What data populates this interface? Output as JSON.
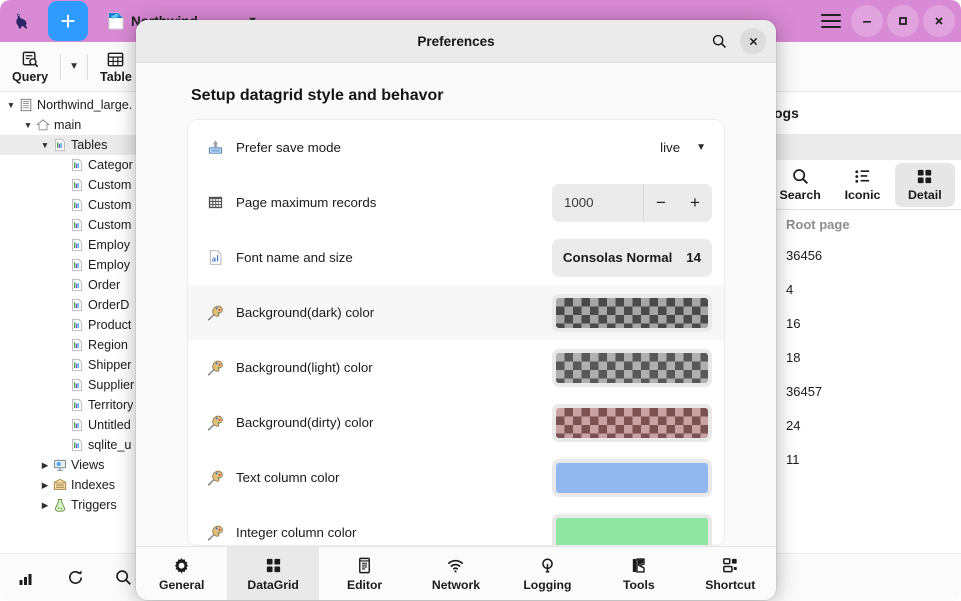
{
  "app": {
    "logo_icon": "kangaroo-logo",
    "new_tab_label": "+",
    "tab_title": "Northwind",
    "window_controls": {
      "menu": "hamburger-icon",
      "minimize": "minimize-icon",
      "maximize": "maximize-icon",
      "close": "close-icon"
    },
    "toolbar": [
      {
        "label": "Query",
        "icon": "query-icon"
      },
      {
        "label": "Table",
        "icon": "table-icon"
      }
    ],
    "statusbar": [
      {
        "icon": "chart-bars-icon",
        "name": "statistics-button"
      },
      {
        "icon": "refresh-icon",
        "name": "refresh-button"
      },
      {
        "icon": "search-icon",
        "name": "search-button"
      }
    ]
  },
  "sidebar": {
    "items": [
      {
        "label": "Northwind_large.",
        "depth": 0,
        "twisty": "down",
        "icon": "database-icon",
        "selected": false
      },
      {
        "label": "main",
        "depth": 1,
        "twisty": "down",
        "icon": "home-icon",
        "selected": false
      },
      {
        "label": "Tables",
        "depth": 2,
        "twisty": "down",
        "icon": "table-icon",
        "selected": true
      },
      {
        "label": "Categor",
        "depth": 3,
        "twisty": "none",
        "icon": "table-icon",
        "selected": false
      },
      {
        "label": "Custom",
        "depth": 3,
        "twisty": "none",
        "icon": "table-icon",
        "selected": false
      },
      {
        "label": "Custom",
        "depth": 3,
        "twisty": "none",
        "icon": "table-icon",
        "selected": false
      },
      {
        "label": "Custom",
        "depth": 3,
        "twisty": "none",
        "icon": "table-icon",
        "selected": false
      },
      {
        "label": "Employ",
        "depth": 3,
        "twisty": "none",
        "icon": "table-icon",
        "selected": false
      },
      {
        "label": "Employ",
        "depth": 3,
        "twisty": "none",
        "icon": "table-icon",
        "selected": false
      },
      {
        "label": "Order",
        "depth": 3,
        "twisty": "none",
        "icon": "table-icon",
        "selected": false
      },
      {
        "label": "OrderD",
        "depth": 3,
        "twisty": "none",
        "icon": "table-icon",
        "selected": false
      },
      {
        "label": "Product",
        "depth": 3,
        "twisty": "none",
        "icon": "table-icon",
        "selected": false
      },
      {
        "label": "Region",
        "depth": 3,
        "twisty": "none",
        "icon": "table-icon",
        "selected": false
      },
      {
        "label": "Shipper",
        "depth": 3,
        "twisty": "none",
        "icon": "table-icon",
        "selected": false
      },
      {
        "label": "Supplier",
        "depth": 3,
        "twisty": "none",
        "icon": "table-icon",
        "selected": false
      },
      {
        "label": "Territory",
        "depth": 3,
        "twisty": "none",
        "icon": "table-icon",
        "selected": false
      },
      {
        "label": "Untitled",
        "depth": 3,
        "twisty": "none",
        "icon": "table-icon",
        "selected": false
      },
      {
        "label": "sqlite_u",
        "depth": 3,
        "twisty": "none",
        "icon": "table-icon",
        "selected": false
      },
      {
        "label": "Views",
        "depth": 2,
        "twisty": "right",
        "icon": "views-icon",
        "selected": false
      },
      {
        "label": "Indexes",
        "depth": 2,
        "twisty": "right",
        "icon": "indexes-icon",
        "selected": false
      },
      {
        "label": "Triggers",
        "depth": 2,
        "twisty": "right",
        "icon": "triggers-icon",
        "selected": false
      }
    ]
  },
  "right_panel": {
    "heading": "ogs",
    "view_buttons": [
      {
        "label": "Search",
        "icon": "search-icon",
        "active": false
      },
      {
        "label": "Iconic",
        "icon": "list-icon",
        "active": false
      },
      {
        "label": "Detail",
        "icon": "grid-icon",
        "active": true
      }
    ],
    "column_header": "Root page",
    "values": [
      "36456",
      "4",
      "16",
      "18",
      "36457",
      "24",
      "11"
    ]
  },
  "dialog": {
    "title": "Preferences",
    "search_icon": "search-icon",
    "close_icon": "close-icon",
    "section_title": "Setup datagrid style and behavor",
    "rows": [
      {
        "label": "Prefer save mode",
        "icon": "save-mode-icon",
        "control": "combo",
        "value": "live",
        "shaded": false
      },
      {
        "label": "Page maximum records",
        "icon": "grid-records-icon",
        "control": "spinner",
        "value": "1000",
        "minus": "−",
        "plus": "+",
        "shaded": false
      },
      {
        "label": "Font name and size",
        "icon": "font-icon",
        "control": "font",
        "value": "Consolas Normal",
        "size": "14",
        "shaded": false
      },
      {
        "label": "Background(dark) color",
        "icon": "palette-icon",
        "control": "swatch",
        "swatch_kind": "checker",
        "color_a": "#a6a6a6",
        "color_b": "#4a4a4a",
        "shaded": true
      },
      {
        "label": "Background(light) color",
        "icon": "palette-icon",
        "control": "swatch",
        "swatch_kind": "checker",
        "color_a": "#b0b0b0",
        "color_b": "#585858",
        "shaded": false
      },
      {
        "label": "Background(dirty) color",
        "icon": "palette-icon",
        "control": "swatch",
        "swatch_kind": "checker",
        "color_a": "#c9a3a3",
        "color_b": "#7b5151",
        "shaded": false
      },
      {
        "label": "Text column color",
        "icon": "palette-icon",
        "control": "swatch",
        "swatch_kind": "solid",
        "color_a": "#93b8ef",
        "color_b": "#93b8ef",
        "shaded": false
      },
      {
        "label": "Integer column color",
        "icon": "palette-icon",
        "control": "swatch",
        "swatch_kind": "solid",
        "color_a": "#90e5a0",
        "color_b": "#90e5a0",
        "shaded": false
      }
    ],
    "footer_tabs": [
      {
        "label": "General",
        "icon": "gear-icon",
        "active": false
      },
      {
        "label": "DataGrid",
        "icon": "grid-icon",
        "active": true
      },
      {
        "label": "Editor",
        "icon": "editor-icon",
        "active": false
      },
      {
        "label": "Network",
        "icon": "wifi-icon",
        "active": false
      },
      {
        "label": "Logging",
        "icon": "bulb-icon",
        "active": false
      },
      {
        "label": "Tools",
        "icon": "tools-icon",
        "active": false
      },
      {
        "label": "Shortcut",
        "icon": "shortcut-icon",
        "active": false
      }
    ]
  },
  "colors": {
    "titlebar": "#d98ad4",
    "accent_blue": "#2f9bff",
    "dialog_header": "#ebebeb",
    "active_tab_bg": "#e9e9e9"
  }
}
